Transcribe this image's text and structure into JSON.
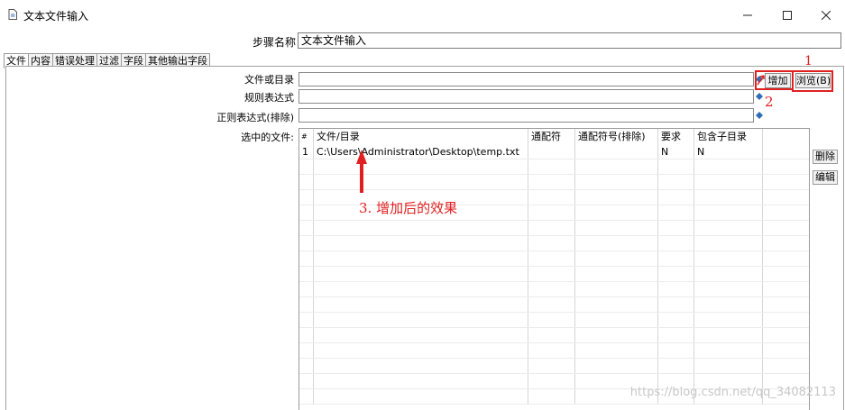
{
  "window": {
    "title": "文本文件输入",
    "minimize_glyph": "—",
    "maximize_glyph": "☐",
    "close_glyph": "✕"
  },
  "step": {
    "label": "步骤名称",
    "value": "文本文件输入"
  },
  "tabs": [
    {
      "label": "文件",
      "active": true
    },
    {
      "label": "内容"
    },
    {
      "label": "错误处理"
    },
    {
      "label": "过滤"
    },
    {
      "label": "字段"
    },
    {
      "label": "其他输出字段"
    }
  ],
  "form": {
    "file_or_dir_label": "文件或目录",
    "regex_label": "规则表达式",
    "regex_exclude_label": "正则表达式(排除)",
    "selected_files_label": "选中的文件:",
    "add_button": "增加",
    "browse_button": "浏览(B)..."
  },
  "annotations": {
    "one": "1",
    "two": "2",
    "three": "3. 增加后的效果"
  },
  "table": {
    "columns": [
      "#",
      "文件/目录",
      "通配符",
      "通配符号(排除)",
      "要求",
      "包含子目录"
    ],
    "rows": [
      [
        "1",
        "C:\\Users\\Administrator\\Desktop\\temp.txt",
        "",
        "",
        "N",
        "N"
      ]
    ]
  },
  "side_buttons": {
    "delete": "删除",
    "edit": "编辑"
  },
  "watermark": "https://blog.csdn.net/qq_34082113",
  "colors": {
    "highlight": "#e02020"
  }
}
